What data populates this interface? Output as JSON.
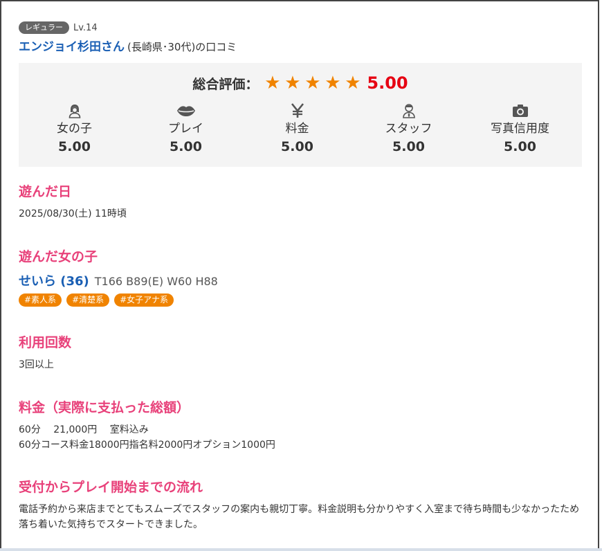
{
  "reviewer": {
    "rank_badge": "レギュラー",
    "level": "Lv.14",
    "name": "エンジョイ杉田さん",
    "meta": "(長崎県･30代)の口コミ"
  },
  "rating": {
    "overall_label": "総合評価：",
    "overall_score": "5.00",
    "stars": 5,
    "star_glyph": "★",
    "categories": [
      {
        "icon": "girl-icon",
        "label": "女の子",
        "score": "5.00"
      },
      {
        "icon": "lips-icon",
        "label": "プレイ",
        "score": "5.00"
      },
      {
        "icon": "yen-icon",
        "label": "料金",
        "score": "5.00"
      },
      {
        "icon": "staff-icon",
        "label": "スタッフ",
        "score": "5.00"
      },
      {
        "icon": "camera-icon",
        "label": "写真信用度",
        "score": "5.00"
      }
    ]
  },
  "sections": {
    "visit_date": {
      "title": "遊んだ日",
      "text": "2025/08/30(土) 11時頃"
    },
    "girl": {
      "title": "遊んだ女の子",
      "name": "せいら (36)",
      "stats": "T166 B89(E) W60 H88",
      "tags": [
        "#素人系",
        "#清楚系",
        "#女子アナ系"
      ]
    },
    "usage": {
      "title": "利用回数",
      "text": "3回以上"
    },
    "price": {
      "title": "料金（実際に支払った総額）",
      "line1": "60分　 21,000円 　室料込み",
      "line2": "60分コース料金18000円指名料2000円オプション1000円"
    },
    "flow": {
      "title": "受付からプレイ開始までの流れ",
      "text": "電話予約から来店までとてもスムーズでスタッフの案内も親切丁寧。料金説明も分かりやすく入室まで待ち時間も少なかったため落ち着いた気持ちでスタートできました。"
    }
  },
  "colors": {
    "accent_pink": "#e8417a",
    "link_blue": "#1a5fb4",
    "star_orange": "#f08300",
    "score_red": "#e60012",
    "tag_orange": "#f08300"
  }
}
